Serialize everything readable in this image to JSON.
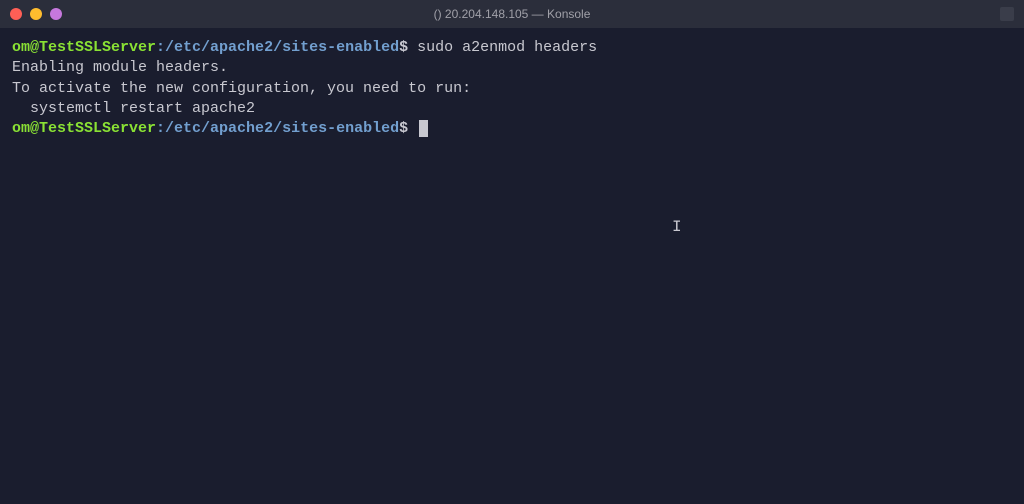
{
  "titlebar": {
    "title": "() 20.204.148.105 — Konsole"
  },
  "prompt": {
    "user_host": "om@TestSSLServer",
    "colon": ":",
    "path": "/etc/apache2/sites-enabled",
    "dollar": "$"
  },
  "lines": {
    "command1": "sudo a2enmod headers",
    "output1": "Enabling module headers.",
    "output2": "To activate the new configuration, you need to run:",
    "output3": "  systemctl restart apache2"
  },
  "text_cursor_glyph": "I"
}
